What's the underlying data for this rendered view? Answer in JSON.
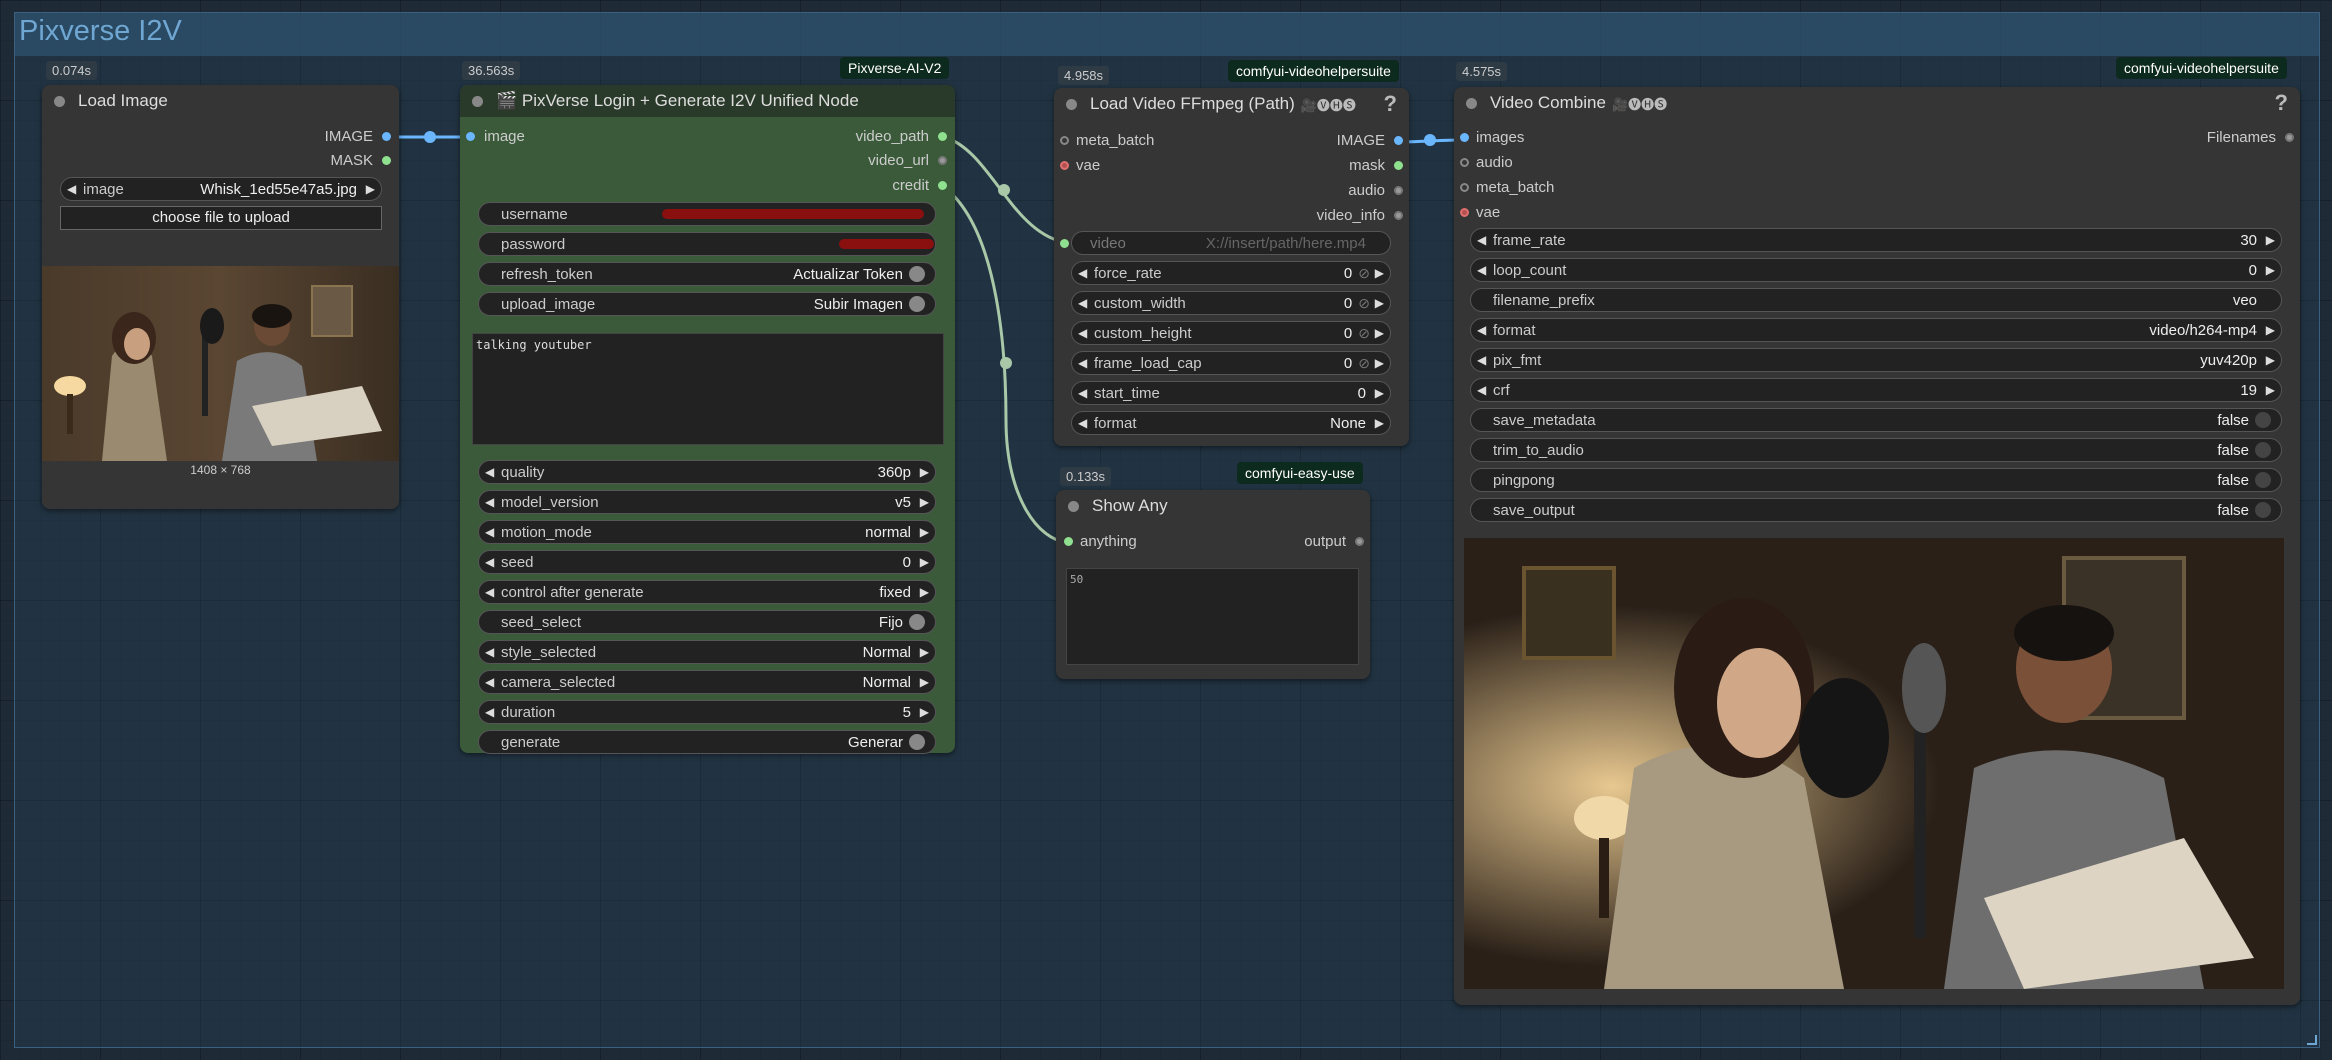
{
  "group": {
    "title": "Pixverse I2V"
  },
  "load_image": {
    "timing": "0.074s",
    "title": "Load Image",
    "outputs": [
      "IMAGE",
      "MASK"
    ],
    "image_widget": {
      "label": "image",
      "value": "Whisk_1ed55e47a5.jpg"
    },
    "upload_button": "choose file to upload",
    "dimensions": "1408 × 768"
  },
  "pixverse": {
    "timing": "36.563s",
    "badge": "Pixverse-AI-V2",
    "title": "🎬 PixVerse Login + Generate I2V Unified Node",
    "input": "image",
    "outputs": [
      "video_path",
      "video_url",
      "credit"
    ],
    "widgets": [
      {
        "label": "username",
        "value": "",
        "kind": "text"
      },
      {
        "label": "password",
        "value": "",
        "kind": "text"
      },
      {
        "label": "refresh_token",
        "value": "Actualizar Token",
        "kind": "toggle"
      },
      {
        "label": "upload_image",
        "value": "Subir Imagen",
        "kind": "toggle"
      }
    ],
    "prompt": "talking youtuber",
    "widgets2": [
      {
        "label": "quality",
        "value": "360p",
        "kind": "combo"
      },
      {
        "label": "model_version",
        "value": "v5",
        "kind": "combo"
      },
      {
        "label": "motion_mode",
        "value": "normal",
        "kind": "combo"
      },
      {
        "label": "seed",
        "value": "0",
        "kind": "combo"
      },
      {
        "label": "control after generate",
        "value": "fixed",
        "kind": "combo"
      },
      {
        "label": "seed_select",
        "value": "Fijo",
        "kind": "toggle"
      },
      {
        "label": "style_selected",
        "value": "Normal",
        "kind": "combo"
      },
      {
        "label": "camera_selected",
        "value": "Normal",
        "kind": "combo"
      },
      {
        "label": "duration",
        "value": "5",
        "kind": "combo"
      },
      {
        "label": "generate",
        "value": "Generar",
        "kind": "toggle"
      }
    ]
  },
  "load_video": {
    "timing": "4.958s",
    "badge": "comfyui-videohelpersuite",
    "title": "Load Video FFmpeg (Path)",
    "title_icons": "🎥🅥🅗🅢",
    "help": "?",
    "inputs": [
      "meta_batch",
      "vae"
    ],
    "outputs": [
      "IMAGE",
      "mask",
      "audio",
      "video_info"
    ],
    "video_widget": {
      "label": "video",
      "value": "X://insert/path/here.mp4"
    },
    "widgets": [
      {
        "label": "force_rate",
        "value": "0"
      },
      {
        "label": "custom_width",
        "value": "0"
      },
      {
        "label": "custom_height",
        "value": "0"
      },
      {
        "label": "frame_load_cap",
        "value": "0"
      },
      {
        "label": "start_time",
        "value": "0"
      },
      {
        "label": "format",
        "value": "None"
      }
    ],
    "null_mark": "⊘"
  },
  "show_any": {
    "timing": "0.133s",
    "badge": "comfyui-easy-use",
    "title": "Show Any",
    "input": "anything",
    "output": "output",
    "text": "50"
  },
  "video_combine": {
    "timing": "4.575s",
    "badge": "comfyui-videohelpersuite",
    "title": "Video Combine",
    "title_icons": "🎥🅥🅗🅢",
    "help": "?",
    "inputs": [
      "images",
      "audio",
      "meta_batch",
      "vae"
    ],
    "output": "Filenames",
    "widgets": [
      {
        "label": "frame_rate",
        "value": "30",
        "kind": "combo"
      },
      {
        "label": "loop_count",
        "value": "0",
        "kind": "combo"
      },
      {
        "label": "filename_prefix",
        "value": "veo",
        "kind": "text"
      },
      {
        "label": "format",
        "value": "video/h264-mp4",
        "kind": "combo"
      },
      {
        "label": "pix_fmt",
        "value": "yuv420p",
        "kind": "combo"
      },
      {
        "label": "crf",
        "value": "19",
        "kind": "combo"
      },
      {
        "label": "save_metadata",
        "value": "false",
        "kind": "toggle"
      },
      {
        "label": "trim_to_audio",
        "value": "false",
        "kind": "toggle"
      },
      {
        "label": "pingpong",
        "value": "false",
        "kind": "toggle"
      },
      {
        "label": "save_output",
        "value": "false",
        "kind": "toggle"
      }
    ]
  },
  "colors": {
    "background": "#1e2a35",
    "group_title": "#6fa7d2",
    "node": "#353535",
    "pixverse_node": "#3a5a3a",
    "image_wire": "#6ab7ff",
    "string_wire": "#a8c8a8"
  }
}
